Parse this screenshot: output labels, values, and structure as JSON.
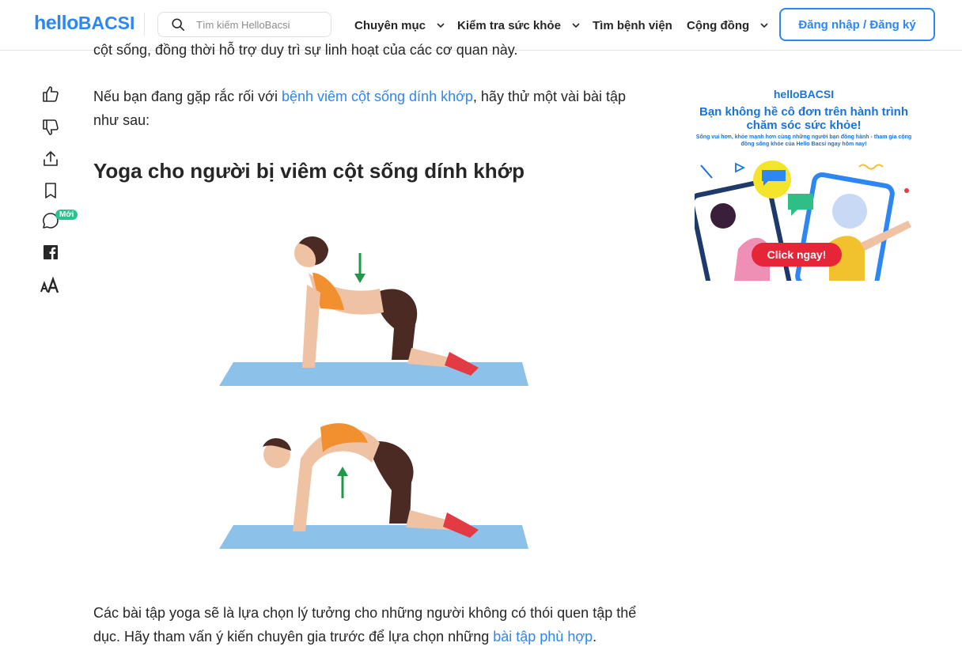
{
  "header": {
    "logo_hello": "hello",
    "logo_bacsi": "BACSI",
    "search_placeholder": "Tìm kiếm HelloBacsi",
    "nav": [
      {
        "label": "Chuyên mục",
        "has_dropdown": true
      },
      {
        "label": "Kiểm tra sức khỏe",
        "has_dropdown": true
      },
      {
        "label": "Tìm bệnh viện",
        "has_dropdown": false
      },
      {
        "label": "Cộng đồng",
        "has_dropdown": true
      }
    ],
    "login_label": "Đăng nhập / Đăng ký"
  },
  "rail": {
    "items": [
      "thumbs-up-icon",
      "thumbs-down-icon",
      "share-icon",
      "bookmark-icon",
      "comment-icon",
      "facebook-icon",
      "font-size-icon"
    ],
    "new_badge": "Mới"
  },
  "article": {
    "top_partial": "cột sống, đồng thời hỗ trợ duy trì sự linh hoạt của các cơ quan này.",
    "p1_before": "Nếu bạn đang gặp rắc rối với ",
    "p1_link": "bệnh viêm cột sống dính khớp",
    "p1_after": ", hãy thử một vài bài tập như sau:",
    "heading": "Yoga cho người bị viêm cột sống dính khớp",
    "p2_before": "Các bài tập yoga sẽ là lựa chọn lý tưởng cho những người không có thói quen tập thể dục. Hãy tham vấn ý kiến chuyên gia trước để lựa chọn những ",
    "p2_link": "bài tập phù hợp",
    "p2_after": "."
  },
  "ad": {
    "brand": "helloBACSI",
    "title": "Bạn không hề cô đơn trên hành trình chăm sóc sức khỏe!",
    "subtitle": "Sống vui hơn, khỏe mạnh hơn cùng những người bạn đồng hành - tham gia cộng đồng sống khỏe của Hello Bacsi ngay hôm nay!",
    "cta": "Click ngay!"
  },
  "colors": {
    "brand_blue": "#2d87f3",
    "text": "#262626",
    "badge_green": "#29c38c",
    "cta_red": "#e62638"
  }
}
